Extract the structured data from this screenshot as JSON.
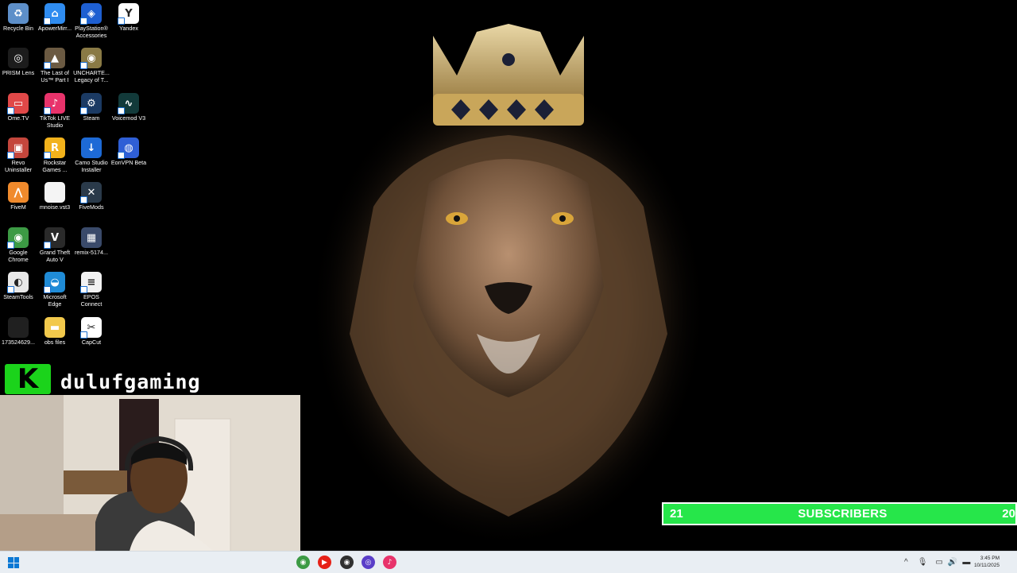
{
  "desktop_icons": [
    {
      "label": "Recycle Bin",
      "color": "#5d8fc9",
      "glyph": "♻",
      "shortcut": false
    },
    {
      "label": "ApowerMirr...",
      "color": "#2f8cf0",
      "glyph": "⌂",
      "shortcut": true
    },
    {
      "label": "PlayStation® Accessories",
      "color": "#1e5fd1",
      "glyph": "◈",
      "shortcut": true
    },
    {
      "label": "Yandex",
      "color": "#ffffff",
      "glyph": "Y",
      "shortcut": true
    },
    {
      "label": "PRISM Lens",
      "color": "#1c1c1c",
      "glyph": "◎",
      "shortcut": false
    },
    {
      "label": "The Last of Us™ Part I",
      "color": "#6b5a42",
      "glyph": "▲",
      "shortcut": true
    },
    {
      "label": "UNCHARTE... Legacy of T...",
      "color": "#8a7a45",
      "glyph": "◉",
      "shortcut": true
    },
    {
      "label": "Ome.TV",
      "color": "#e04848",
      "glyph": "▭",
      "shortcut": true
    },
    {
      "label": "TikTok LIVE Studio",
      "color": "#e8336b",
      "glyph": "♪",
      "shortcut": true
    },
    {
      "label": "Steam",
      "color": "#1b3a63",
      "glyph": "⚙",
      "shortcut": true
    },
    {
      "label": "Voicemod V3",
      "color": "#123a3a",
      "glyph": "∿",
      "shortcut": true
    },
    {
      "label": "Revo Uninstaller",
      "color": "#c4463c",
      "glyph": "▣",
      "shortcut": true
    },
    {
      "label": "Rockstar Games ...",
      "color": "#f2b21b",
      "glyph": "R",
      "shortcut": true
    },
    {
      "label": "Camo Studio Installer",
      "color": "#1d6ad6",
      "glyph": "↓",
      "shortcut": false
    },
    {
      "label": "EonVPN Beta",
      "color": "#2f5fd6",
      "glyph": "◍",
      "shortcut": true
    },
    {
      "label": "FiveM",
      "color": "#f08a2c",
      "glyph": "⋀",
      "shortcut": false
    },
    {
      "label": "mnoise.vst3",
      "color": "#f4f4f4",
      "glyph": "",
      "shortcut": false
    },
    {
      "label": "FiveMods",
      "color": "#2a3a4a",
      "glyph": "✕",
      "shortcut": true
    },
    {
      "label": "Google Chrome",
      "color": "#3c9a44",
      "glyph": "◉",
      "shortcut": true
    },
    {
      "label": "Grand Theft Auto V",
      "color": "#2a2a2a",
      "glyph": "V",
      "shortcut": true
    },
    {
      "label": "remix-5174...",
      "color": "#3a4a6a",
      "glyph": "▦",
      "shortcut": false
    },
    {
      "label": "SteamTools",
      "color": "#e8e8e8",
      "glyph": "◐",
      "shortcut": true
    },
    {
      "label": "Microsoft Edge",
      "color": "#1f8bd6",
      "glyph": "◒",
      "shortcut": true
    },
    {
      "label": "EPOS Connect",
      "color": "#f2f2f2",
      "glyph": "≡",
      "shortcut": true
    },
    {
      "label": "173524629...",
      "color": "#202020",
      "glyph": "",
      "shortcut": false
    },
    {
      "label": "obs files",
      "color": "#f2c94c",
      "glyph": "▬",
      "shortcut": false
    },
    {
      "label": "CapCut",
      "color": "#ffffff",
      "glyph": "✂",
      "shortcut": true
    }
  ],
  "brand": {
    "logo_letter": "K",
    "name": "dulufgaming"
  },
  "subscriber_bar": {
    "left_value": "21",
    "title": "SUBSCRIBERS",
    "right_value": "20",
    "color": "#26e64a"
  },
  "taskbar": {
    "apps": [
      {
        "name": "chrome",
        "color": "#3c9a44",
        "glyph": "◉"
      },
      {
        "name": "youtube",
        "color": "#e62117",
        "glyph": "▶"
      },
      {
        "name": "obs",
        "color": "#303030",
        "glyph": "◉"
      },
      {
        "name": "app-purple",
        "color": "#5a3ec8",
        "glyph": "◎"
      },
      {
        "name": "tiktok",
        "color": "#e8336b",
        "glyph": "♪"
      }
    ],
    "time": "3:45 PM",
    "date": "10/11/2025"
  }
}
